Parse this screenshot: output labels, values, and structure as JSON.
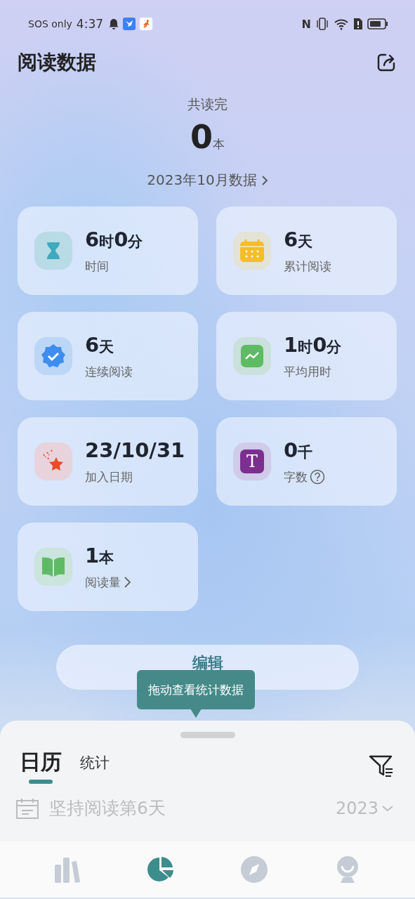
{
  "status_bar": {
    "carrier": "SOS only",
    "time": "4:37",
    "nfc_label": "N"
  },
  "header": {
    "title": "阅读数据"
  },
  "summary": {
    "label": "共读完",
    "count": "0",
    "unit": "本",
    "period_link": "2023年10月数据"
  },
  "cards": [
    {
      "kind": "hourglass",
      "value": [
        {
          "text": "6",
          "kind": "number"
        },
        {
          "text": "时",
          "kind": "unit"
        },
        {
          "text": "0",
          "kind": "number"
        },
        {
          "text": "分",
          "kind": "unit"
        }
      ],
      "label": "时间"
    },
    {
      "kind": "calendar",
      "value": [
        {
          "text": "6",
          "kind": "number"
        },
        {
          "text": "天",
          "kind": "unit"
        }
      ],
      "label": "累计阅读"
    },
    {
      "kind": "badge",
      "value": [
        {
          "text": "6",
          "kind": "number"
        },
        {
          "text": "天",
          "kind": "unit"
        }
      ],
      "label": "连续阅读"
    },
    {
      "kind": "trend",
      "value": [
        {
          "text": "1",
          "kind": "number"
        },
        {
          "text": "时",
          "kind": "unit"
        },
        {
          "text": "0",
          "kind": "number"
        },
        {
          "text": "分",
          "kind": "unit"
        }
      ],
      "label": "平均用时"
    },
    {
      "kind": "star",
      "value": [
        {
          "text": "23/10/31",
          "kind": "number"
        }
      ],
      "label": "加入日期"
    },
    {
      "kind": "letter",
      "letter": "T",
      "value": [
        {
          "text": "0",
          "kind": "number"
        },
        {
          "text": "千",
          "kind": "unit"
        }
      ],
      "label": "字数",
      "has_help": true
    },
    {
      "kind": "book",
      "value": [
        {
          "text": "1",
          "kind": "number"
        },
        {
          "text": "本",
          "kind": "unit"
        }
      ],
      "label": "阅读量",
      "has_link": true
    }
  ],
  "edit_button": {
    "label": "编辑"
  },
  "tooltip": {
    "text": "拖动查看统计数据"
  },
  "sheet": {
    "tabs": [
      {
        "label": "日历",
        "selected": true
      },
      {
        "label": "统计",
        "selected": false
      }
    ],
    "streak": "坚持阅读第6天",
    "year": "2023"
  },
  "bottom_nav": [
    {
      "kind": "shelf",
      "selected": false
    },
    {
      "kind": "pie",
      "selected": true
    },
    {
      "kind": "compass",
      "selected": false
    },
    {
      "kind": "profile",
      "selected": false
    }
  ]
}
